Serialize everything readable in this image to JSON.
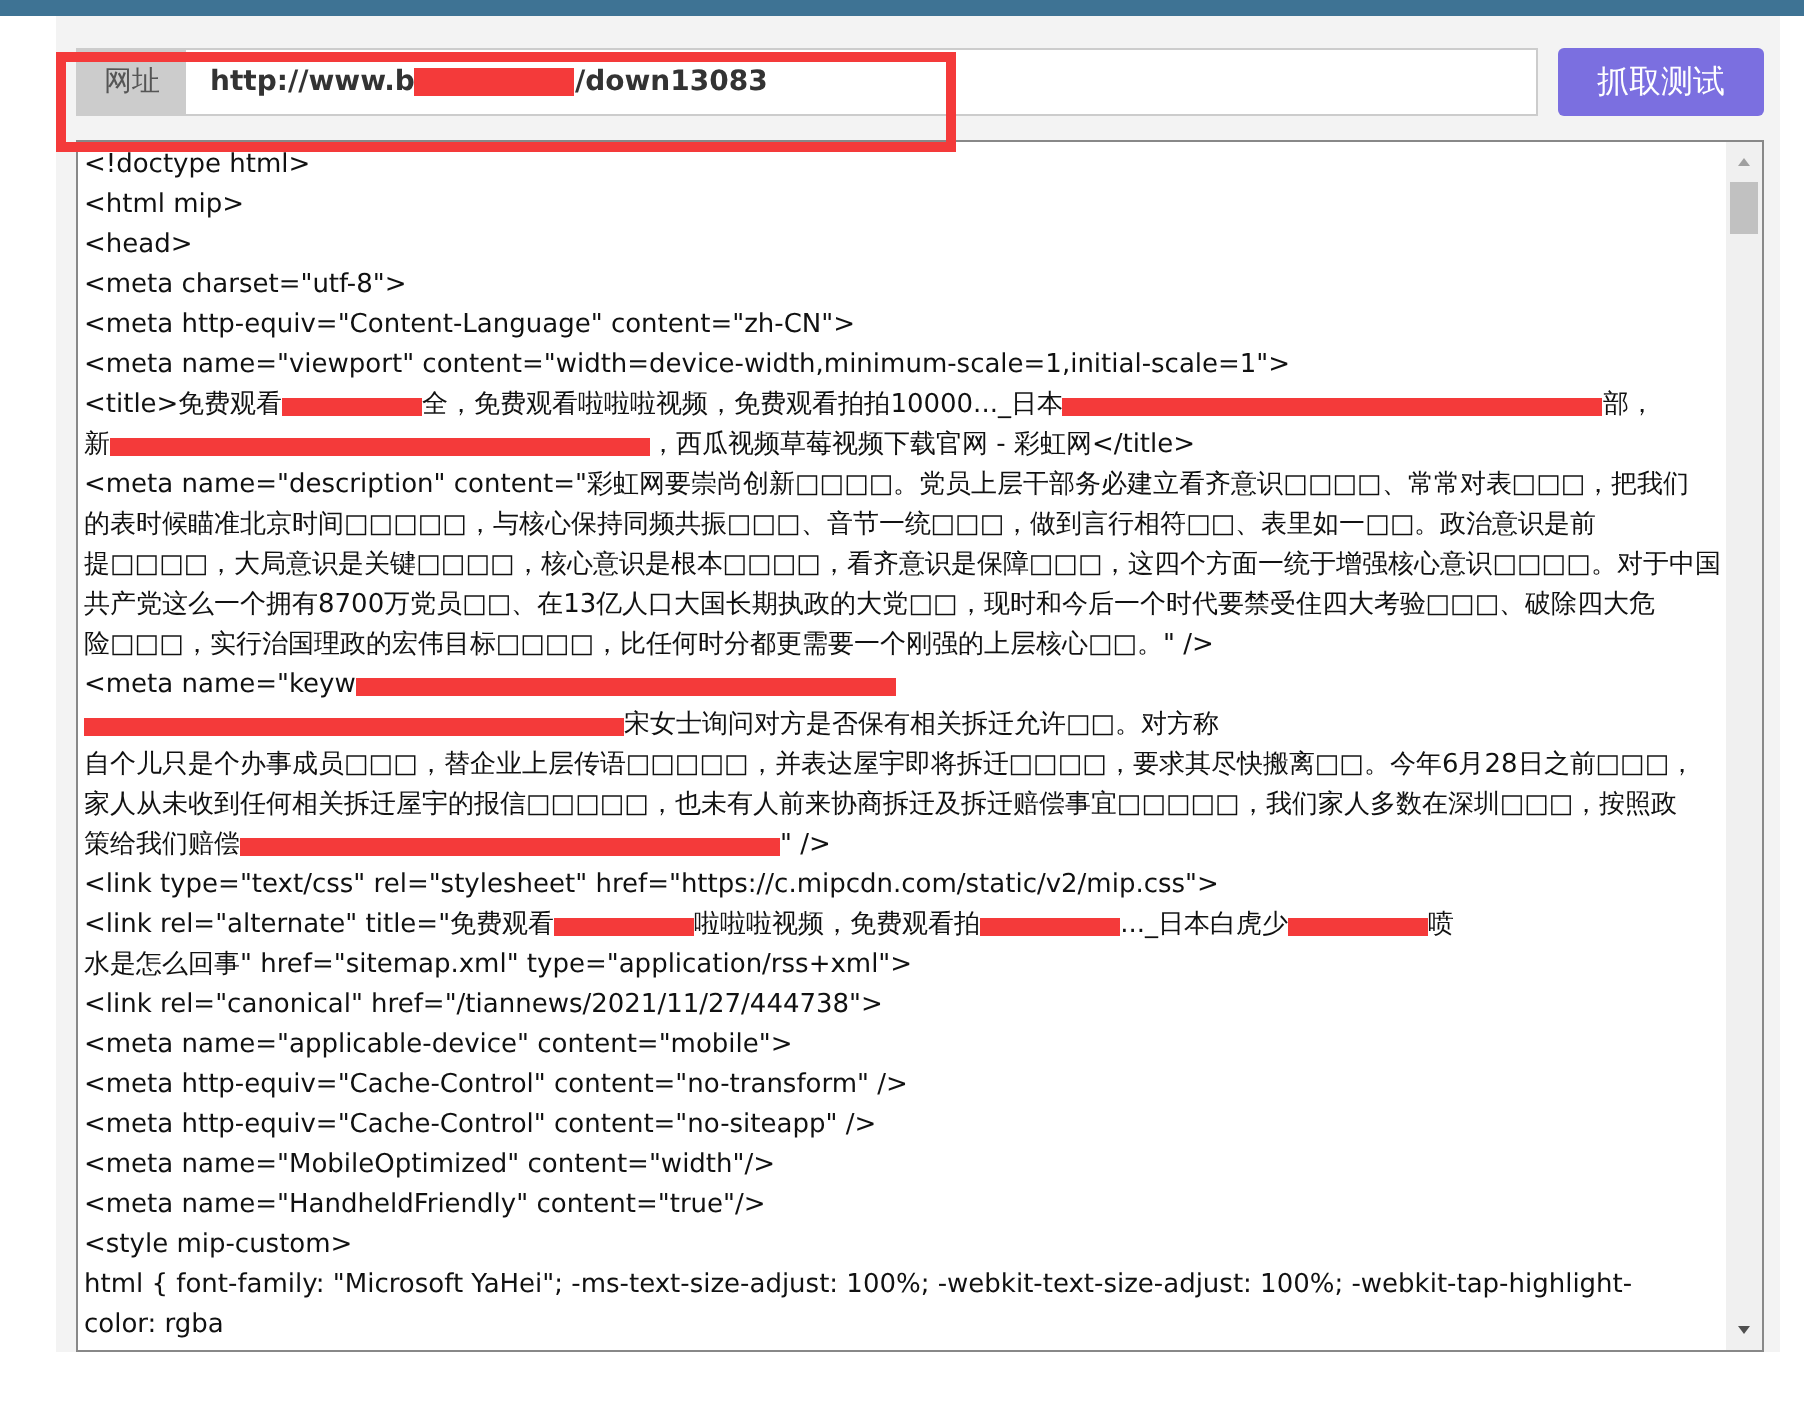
{
  "url_bar": {
    "label": "网址",
    "value": [
      {
        "text": "http://www.b"
      },
      {
        "kind": "redaction"
      },
      {
        "text": "/down13083"
      }
    ]
  },
  "fetch_button": "抓取测试",
  "source_lines": [
    [
      {
        "text": "<!doctype html>"
      }
    ],
    [
      {
        "text": "<html mip>"
      }
    ],
    [
      {
        "text": "<head>"
      }
    ],
    [
      {
        "text": "<meta charset=\"utf-8\">"
      }
    ],
    [
      {
        "text": "<meta http-equiv=\"Content-Language\" content=\"zh-CN\">"
      }
    ],
    [
      {
        "text": "<meta name=\"viewport\" content=\"width=device-width,minimum-scale=1,initial-scale=1\">"
      }
    ],
    [
      {
        "text": "<title>免费观看"
      },
      {
        "kind": "redaction"
      },
      {
        "text": "全，免费观看啦啦啦视频，免费观看拍拍10000..._日本"
      },
      {
        "kind": "redaction",
        "wide": true
      },
      {
        "text": "部，"
      }
    ],
    [
      {
        "text": "新"
      },
      {
        "kind": "redaction",
        "wide": true
      },
      {
        "text": "，西瓜视频草莓视频下载官网 - 彩虹网</title>"
      }
    ],
    [
      {
        "text": "<meta name=\"description\" content=\"彩虹网要崇尚创新□□□□。党员上层干部务必建立看齐意识□□□□、常常对表□□□，把我们"
      }
    ],
    [
      {
        "text": "的表时候瞄准北京时间□□□□□，与核心保持同频共振□□□、音节一统□□□，做到言行相符□□、表里如一□□。政治意识是前"
      }
    ],
    [
      {
        "text": "提□□□□，大局意识是关键□□□□，核心意识是根本□□□□，看齐意识是保障□□□，这四个方面一统于增强核心意识□□□□。对于中国"
      }
    ],
    [
      {
        "text": "共产党这么一个拥有8700万党员□□、在13亿人口大国长期执政的大党□□，现时和今后一个时代要禁受住四大考验□□□、破除四大危"
      }
    ],
    [
      {
        "text": "险□□□，实行治国理政的宏伟目标□□□□，比任何时分都更需要一个刚强的上层核心□□。\" />"
      }
    ],
    [
      {
        "text": "<meta name=\"keyw"
      },
      {
        "kind": "redaction",
        "wide": true
      }
    ],
    [
      {
        "kind": "redaction",
        "wide": true
      },
      {
        "text": "宋女士询问对方是否保有相关拆迁允许□□。对方称"
      }
    ],
    [
      {
        "text": "自个儿只是个办事成员□□□，替企业上层传语□□□□□，并表达屋宇即将拆迁□□□□，要求其尽快搬离□□。今年6月28日之前□□□，"
      }
    ],
    [
      {
        "text": "家人从未收到任何相关拆迁屋宇的报信□□□□□，也未有人前来协商拆迁及拆迁赔偿事宜□□□□□，我们家人多数在深圳□□□，按照政"
      }
    ],
    [
      {
        "text": "策给我们赔偿"
      },
      {
        "kind": "redaction",
        "wide": true
      },
      {
        "text": "\" />"
      }
    ],
    [
      {
        "text": "<link type=\"text/css\" rel=\"stylesheet\" href=\"https://c.mipcdn.com/static/v2/mip.css\">"
      }
    ],
    [
      {
        "text": "<link rel=\"alternate\" title=\"免费观看"
      },
      {
        "kind": "redaction"
      },
      {
        "text": "啦啦啦视频，免费观看拍"
      },
      {
        "kind": "redaction"
      },
      {
        "text": "..._日本白虎少"
      },
      {
        "kind": "redaction"
      },
      {
        "text": "喷"
      }
    ],
    [
      {
        "text": "水是怎么回事\" href=\"sitemap.xml\" type=\"application/rss+xml\">"
      }
    ],
    [
      {
        "text": "<link rel=\"canonical\" href=\"/tiannews/2021/11/27/444738\">"
      }
    ],
    [
      {
        "text": "<meta name=\"applicable-device\" content=\"mobile\">"
      }
    ],
    [
      {
        "text": "<meta http-equiv=\"Cache-Control\" content=\"no-transform\" />"
      }
    ],
    [
      {
        "text": "<meta http-equiv=\"Cache-Control\" content=\"no-siteapp\" />"
      }
    ],
    [
      {
        "text": "<meta name=\"MobileOptimized\" content=\"width\"/>"
      }
    ],
    [
      {
        "text": "<meta name=\"HandheldFriendly\" content=\"true\"/>"
      }
    ],
    [
      {
        "text": "<style mip-custom>"
      }
    ],
    [
      {
        "text": "html { font-family: \"Microsoft YaHei\"; -ms-text-size-adjust: 100%; -webkit-text-size-adjust: 100%; -webkit-tap-highlight-"
      }
    ],
    [
      {
        "text": "color: rgba"
      }
    ]
  ]
}
